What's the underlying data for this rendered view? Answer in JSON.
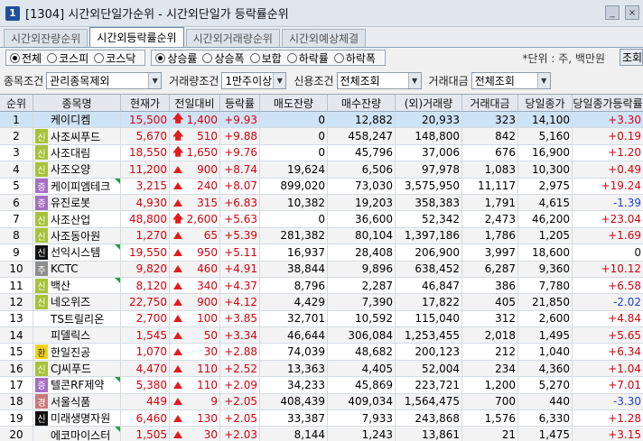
{
  "window": {
    "number": "1",
    "title": "[1304] 시간외단일가순위 - 시간외단일가 등락률순위",
    "btn_minimize": "_",
    "btn_close": "×"
  },
  "tabs": [
    {
      "label": "시간외잔량순위",
      "active": false
    },
    {
      "label": "시간외등락률순위",
      "active": true
    },
    {
      "label": "시간외거래량순위",
      "active": false
    },
    {
      "label": "시간외예상체결",
      "active": false
    }
  ],
  "market_options": [
    {
      "label": "전체",
      "selected": true
    },
    {
      "label": "코스피",
      "selected": false
    },
    {
      "label": "코스닥",
      "selected": false
    }
  ],
  "rank_options": [
    {
      "label": "상승률",
      "selected": true
    },
    {
      "label": "상승폭",
      "selected": false
    },
    {
      "label": "보합",
      "selected": false
    },
    {
      "label": "하락률",
      "selected": false
    },
    {
      "label": "하락폭",
      "selected": false
    }
  ],
  "unit_text": "*단위 : 주, 백만원",
  "query_button": "조회",
  "filters": {
    "stock_condition_label": "종목조건",
    "stock_condition_value": "관리종목제외",
    "volume_condition_label": "거래량조건",
    "volume_condition_value": "1만주이상",
    "credit_condition_label": "신용조건",
    "credit_condition_value": "전체조회",
    "amount_label": "거래대금",
    "amount_value": "전체조회"
  },
  "columns": [
    "순위",
    "종목명",
    "현재가",
    "전일대비",
    "등락률",
    "매도잔량",
    "매수잔량",
    "(외)거래량",
    "거래대금",
    "당일종가",
    "당일종가등락률"
  ],
  "rows": [
    {
      "rank": "1",
      "badge": "",
      "badge_color": "none",
      "name": "케이디켐",
      "flag": false,
      "price": "15,500",
      "arrow": "up-bold",
      "change": "1,400",
      "rate": "+9.93",
      "ask": "0",
      "bid": "12,882",
      "volume": "20,933",
      "amount": "323",
      "close": "14,100",
      "close_rate": "+3.30",
      "close_dir": "up"
    },
    {
      "rank": "2",
      "badge": "신",
      "badge_color": "g",
      "name": "사조씨푸드",
      "flag": false,
      "price": "5,670",
      "arrow": "up-bold",
      "change": "510",
      "rate": "+9.88",
      "ask": "0",
      "bid": "458,247",
      "volume": "148,800",
      "amount": "842",
      "close": "5,160",
      "close_rate": "+0.19",
      "close_dir": "up"
    },
    {
      "rank": "3",
      "badge": "신",
      "badge_color": "g",
      "name": "사조대림",
      "flag": false,
      "price": "18,550",
      "arrow": "up-bold",
      "change": "1,650",
      "rate": "+9.76",
      "ask": "0",
      "bid": "45,796",
      "volume": "37,006",
      "amount": "676",
      "close": "16,900",
      "close_rate": "+1.20",
      "close_dir": "up"
    },
    {
      "rank": "4",
      "badge": "신",
      "badge_color": "g",
      "name": "사조오양",
      "flag": false,
      "price": "11,200",
      "arrow": "up",
      "change": "900",
      "rate": "+8.74",
      "ask": "19,624",
      "bid": "6,506",
      "volume": "97,978",
      "amount": "1,083",
      "close": "10,300",
      "close_rate": "+0.49",
      "close_dir": "up"
    },
    {
      "rank": "5",
      "badge": "증",
      "badge_color": "p",
      "name": "케이피엠테크",
      "flag": true,
      "price": "3,215",
      "arrow": "up",
      "change": "240",
      "rate": "+8.07",
      "ask": "899,020",
      "bid": "73,030",
      "volume": "3,575,950",
      "amount": "11,117",
      "close": "2,975",
      "close_rate": "+19.24",
      "close_dir": "up"
    },
    {
      "rank": "6",
      "badge": "증",
      "badge_color": "p",
      "name": "유진로봇",
      "flag": false,
      "price": "4,930",
      "arrow": "up",
      "change": "315",
      "rate": "+6.83",
      "ask": "10,382",
      "bid": "19,203",
      "volume": "358,383",
      "amount": "1,791",
      "close": "4,615",
      "close_rate": "-1.39",
      "close_dir": "dn"
    },
    {
      "rank": "7",
      "badge": "신",
      "badge_color": "g",
      "name": "사조산업",
      "flag": false,
      "price": "48,800",
      "arrow": "up-bold",
      "change": "2,600",
      "rate": "+5.63",
      "ask": "0",
      "bid": "36,600",
      "volume": "52,342",
      "amount": "2,473",
      "close": "46,200",
      "close_rate": "+23.04",
      "close_dir": "up"
    },
    {
      "rank": "8",
      "badge": "신",
      "badge_color": "g",
      "name": "사조동아원",
      "flag": false,
      "price": "1,270",
      "arrow": "up",
      "change": "65",
      "rate": "+5.39",
      "ask": "281,382",
      "bid": "80,104",
      "volume": "1,397,186",
      "amount": "1,786",
      "close": "1,205",
      "close_rate": "+1.69",
      "close_dir": "up"
    },
    {
      "rank": "9",
      "badge": "신",
      "badge_color": "k",
      "name": "선익시스템",
      "flag": true,
      "price": "19,550",
      "arrow": "up",
      "change": "950",
      "rate": "+5.11",
      "ask": "16,937",
      "bid": "28,408",
      "volume": "206,900",
      "amount": "3,997",
      "close": "18,600",
      "close_rate": "0",
      "close_dir": "blk"
    },
    {
      "rank": "10",
      "badge": "주",
      "badge_color": "gr",
      "name": "KCTC",
      "flag": false,
      "price": "9,820",
      "arrow": "up",
      "change": "460",
      "rate": "+4.91",
      "ask": "38,844",
      "bid": "9,896",
      "volume": "638,452",
      "amount": "6,287",
      "close": "9,360",
      "close_rate": "+10.12",
      "close_dir": "up"
    },
    {
      "rank": "11",
      "badge": "신",
      "badge_color": "g",
      "name": "백산",
      "flag": true,
      "price": "8,120",
      "arrow": "up",
      "change": "340",
      "rate": "+4.37",
      "ask": "8,796",
      "bid": "2,287",
      "volume": "46,847",
      "amount": "386",
      "close": "7,780",
      "close_rate": "+6.58",
      "close_dir": "up"
    },
    {
      "rank": "12",
      "badge": "신",
      "badge_color": "g",
      "name": "네오위즈",
      "flag": false,
      "price": "22,750",
      "arrow": "up",
      "change": "900",
      "rate": "+4.12",
      "ask": "4,429",
      "bid": "7,390",
      "volume": "17,822",
      "amount": "405",
      "close": "21,850",
      "close_rate": "-2.02",
      "close_dir": "dn"
    },
    {
      "rank": "13",
      "badge": "",
      "badge_color": "none",
      "name": "TS트릴리온",
      "flag": false,
      "price": "2,700",
      "arrow": "up",
      "change": "100",
      "rate": "+3.85",
      "ask": "32,701",
      "bid": "10,592",
      "volume": "115,040",
      "amount": "312",
      "close": "2,600",
      "close_rate": "+4.84",
      "close_dir": "up"
    },
    {
      "rank": "14",
      "badge": "",
      "badge_color": "none",
      "name": "피델릭스",
      "flag": false,
      "price": "1,545",
      "arrow": "up",
      "change": "50",
      "rate": "+3.34",
      "ask": "46,644",
      "bid": "306,084",
      "volume": "1,253,455",
      "amount": "2,018",
      "close": "1,495",
      "close_rate": "+5.65",
      "close_dir": "up"
    },
    {
      "rank": "15",
      "badge": "환",
      "badge_color": "y",
      "name": "한일진공",
      "flag": false,
      "price": "1,070",
      "arrow": "up",
      "change": "30",
      "rate": "+2.88",
      "ask": "74,039",
      "bid": "48,682",
      "volume": "200,123",
      "amount": "212",
      "close": "1,040",
      "close_rate": "+6.34",
      "close_dir": "up"
    },
    {
      "rank": "16",
      "badge": "신",
      "badge_color": "g",
      "name": "CJ씨푸드",
      "flag": false,
      "price": "4,470",
      "arrow": "up",
      "change": "110",
      "rate": "+2.52",
      "ask": "13,363",
      "bid": "4,405",
      "volume": "52,004",
      "amount": "234",
      "close": "4,360",
      "close_rate": "+1.04",
      "close_dir": "up"
    },
    {
      "rank": "17",
      "badge": "증",
      "badge_color": "p",
      "name": "텔콘RF제약",
      "flag": true,
      "price": "5,380",
      "arrow": "up",
      "change": "110",
      "rate": "+2.09",
      "ask": "34,233",
      "bid": "45,869",
      "volume": "223,721",
      "amount": "1,200",
      "close": "5,270",
      "close_rate": "+7.01",
      "close_dir": "up"
    },
    {
      "rank": "18",
      "badge": "경",
      "badge_color": "r",
      "name": "서울식품",
      "flag": false,
      "price": "449",
      "arrow": "up",
      "change": "9",
      "rate": "+2.05",
      "ask": "408,439",
      "bid": "409,034",
      "volume": "1,564,475",
      "amount": "700",
      "close": "440",
      "close_rate": "-3.30",
      "close_dir": "dn"
    },
    {
      "rank": "19",
      "badge": "신",
      "badge_color": "k",
      "name": "미래생명자원",
      "flag": false,
      "price": "6,460",
      "arrow": "up",
      "change": "130",
      "rate": "+2.05",
      "ask": "33,387",
      "bid": "7,933",
      "volume": "243,868",
      "amount": "1,576",
      "close": "6,330",
      "close_rate": "+1.28",
      "close_dir": "up"
    },
    {
      "rank": "20",
      "badge": "",
      "badge_color": "none",
      "name": "에코마이스터",
      "flag": true,
      "price": "1,505",
      "arrow": "up",
      "change": "30",
      "rate": "+2.03",
      "ask": "8,144",
      "bid": "1,243",
      "volume": "13,861",
      "amount": "21",
      "close": "1,475",
      "close_rate": "+3.15",
      "close_dir": "up"
    }
  ],
  "colors": {
    "up": "#d8000c",
    "down": "#1c3fd8",
    "selected_row": "#cfe3f6"
  }
}
